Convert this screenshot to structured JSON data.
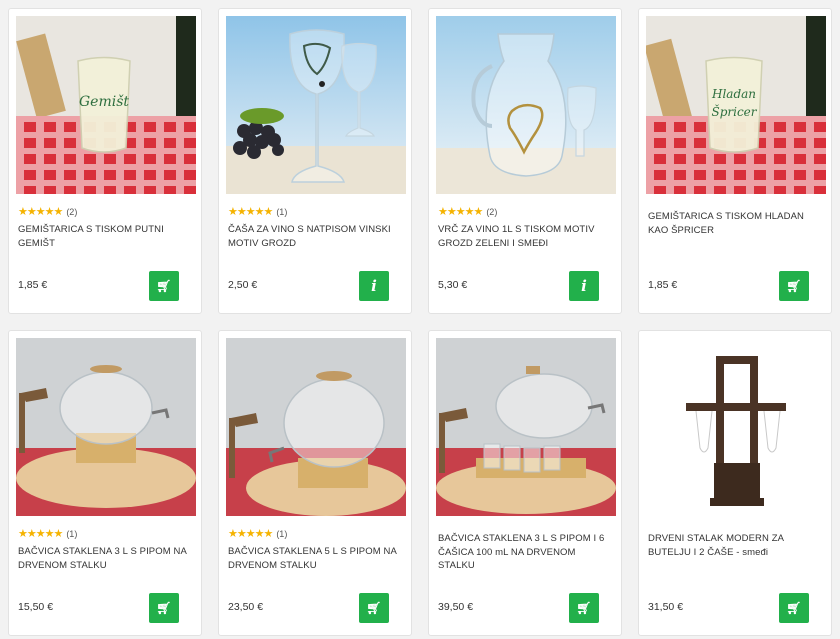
{
  "products": [
    {
      "title": "GEMIŠTARICA S TISKOM PUTNI GEMIŠT",
      "price": "1,85 €",
      "stars": "★★★★★",
      "reviews": "(2)",
      "button": "cart-icon",
      "image": "glass-gemist"
    },
    {
      "title": "ČAŠA ZA VINO S NATPISOM VINSKI MOTIV GROZD",
      "price": "2,50 €",
      "stars": "★★★★★",
      "reviews": "(1)",
      "button": "info-icon",
      "image": "wine-glass"
    },
    {
      "title": "VRČ ZA VINO 1L S TISKOM MOTIV GROZD ZELENI I SMEĐI",
      "price": "5,30 €",
      "stars": "★★★★★",
      "reviews": "(2)",
      "button": "info-icon",
      "image": "jug"
    },
    {
      "title": "GEMIŠTARICA S TISKOM HLADAN KAO ŠPRICER",
      "price": "1,85 €",
      "stars": "",
      "reviews": "",
      "button": "cart-icon",
      "image": "glass-spricer"
    },
    {
      "title": "BAČVICA STAKLENA 3 L S PIPOM NA DRVENOM STALKU",
      "price": "15,50 €",
      "stars": "★★★★★",
      "reviews": "(1)",
      "button": "cart-icon",
      "image": "barrel"
    },
    {
      "title": "BAČVICA STAKLENA 5 L S PIPOM NA DRVENOM STALKU",
      "price": "23,50 €",
      "stars": "★★★★★",
      "reviews": "(1)",
      "button": "cart-icon",
      "image": "barrel"
    },
    {
      "title": "BAČVICA STAKLENA 3 L S PIPOM I 6 ČAŠICA 100 mL NA DRVENOM STALKU",
      "price": "39,50 €",
      "stars": "",
      "reviews": "",
      "button": "cart-icon",
      "image": "barrel-cups"
    },
    {
      "title": "DRVENI STALAK MODERN ZA BUTELJU I 2 ČAŠE - smeđi",
      "price": "31,50 €",
      "stars": "",
      "reviews": "",
      "button": "cart-icon",
      "image": "stand"
    }
  ],
  "colors": {
    "accent": "#22b04b",
    "star": "#f5b301"
  }
}
